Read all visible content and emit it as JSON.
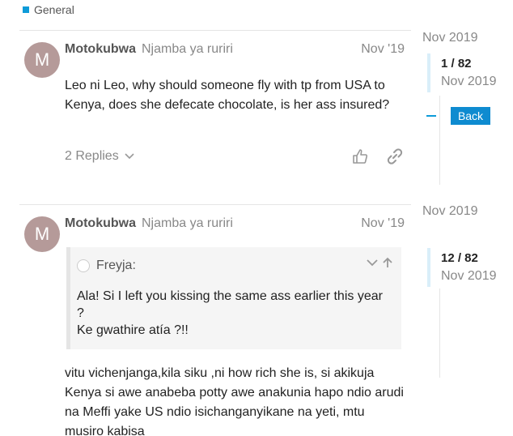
{
  "category": {
    "label": "General",
    "color": "#0e9bd8"
  },
  "posts": [
    {
      "avatar_letter": "M",
      "username": "Motokubwa",
      "fullname": "Njamba ya ruriri",
      "date": "Nov '19",
      "body": "Leo ni Leo, why should someone fly with tp from USA to Kenya, does she defecate chocolate, is her ass insured?",
      "replies_label": "2 Replies"
    },
    {
      "avatar_letter": "M",
      "username": "Motokubwa",
      "fullname": "Njamba ya ruriri",
      "date": "Nov '19",
      "quote": {
        "author": "Freyja:",
        "line1": "Ala! Si I left you kissing the same ass earlier this year ?",
        "line2": "Ke gwathire atía ?!!"
      },
      "body": "vitu vichenjanga,kila siku ,ni how rich she is, si akikuja Kenya si awe anabeba potty awe anakunia hapo ndio arudi na Meffi yake US ndio isichanganyikane na yeti, mtu musiro kabisa"
    }
  ],
  "timeline": [
    {
      "date": "Nov 2019",
      "position": "1 / 82",
      "sub_date": "Nov 2019",
      "back_label": "Back"
    },
    {
      "date": "Nov 2019",
      "position": "12 / 82",
      "sub_date": "Nov 2019"
    }
  ]
}
